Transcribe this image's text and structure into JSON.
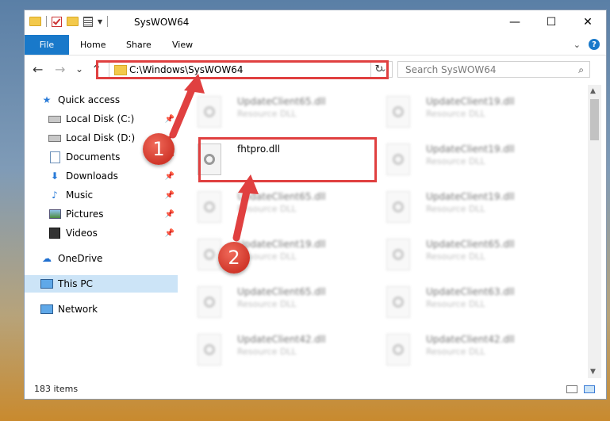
{
  "window": {
    "title": "SysWOW64",
    "controls": {
      "minimize": "—",
      "maximize": "☐",
      "close": "✕"
    }
  },
  "ribbon": {
    "file_tab": "File",
    "tabs": [
      "Home",
      "Share",
      "View"
    ],
    "help": "?"
  },
  "navigation": {
    "back": "←",
    "forward": "→",
    "recent": "⌄",
    "up": "↑",
    "address": "C:\\Windows\\SysWOW64",
    "search_placeholder": "Search SysWOW64"
  },
  "sidebar": {
    "items": [
      {
        "label": "Quick access",
        "icon": "star-icon",
        "pinned": false
      },
      {
        "label": "Local Disk (C:)",
        "icon": "drive-icon",
        "pinned": true
      },
      {
        "label": "Local Disk (D:)",
        "icon": "drive-icon",
        "pinned": true
      },
      {
        "label": "Documents",
        "icon": "documents-icon",
        "pinned": true
      },
      {
        "label": "Downloads",
        "icon": "download-icon",
        "pinned": true
      },
      {
        "label": "Music",
        "icon": "music-icon",
        "pinned": true
      },
      {
        "label": "Pictures",
        "icon": "pictures-icon",
        "pinned": true
      },
      {
        "label": "Videos",
        "icon": "videos-icon",
        "pinned": true
      },
      {
        "label": "OneDrive",
        "icon": "onedrive-icon",
        "pinned": false
      },
      {
        "label": "This PC",
        "icon": "computer-icon",
        "pinned": false,
        "selected": true
      },
      {
        "label": "Network",
        "icon": "network-icon",
        "pinned": false
      }
    ]
  },
  "files": {
    "highlighted": {
      "name": "fhtpro.dll"
    },
    "left_column": [
      {
        "name": "UpdateClient65.dll",
        "type": "Resource DLL"
      },
      {
        "name": "UpdateClient65.dll",
        "type": "Resource DLL"
      },
      {
        "name": "UpdateClient19.dll",
        "type": "Resource DLL"
      },
      {
        "name": "UpdateClient65.dll",
        "type": "Resource DLL"
      },
      {
        "name": "UpdateClient42.dll",
        "type": "Resource DLL"
      }
    ],
    "right_column": [
      {
        "name": "UpdateClient19.dll",
        "type": "Resource DLL"
      },
      {
        "name": "UpdateClient19.dll",
        "type": "Resource DLL"
      },
      {
        "name": "UpdateClient19.dll",
        "type": "Resource DLL"
      },
      {
        "name": "UpdateClient65.dll",
        "type": "Resource DLL"
      },
      {
        "name": "UpdateClient63.dll",
        "type": "Resource DLL"
      },
      {
        "name": "UpdateClient42.dll",
        "type": "Resource DLL"
      }
    ]
  },
  "status": {
    "item_count": "183 items"
  },
  "annotations": {
    "badge1": "1",
    "badge2": "2",
    "highlight_color": "#e04040"
  }
}
